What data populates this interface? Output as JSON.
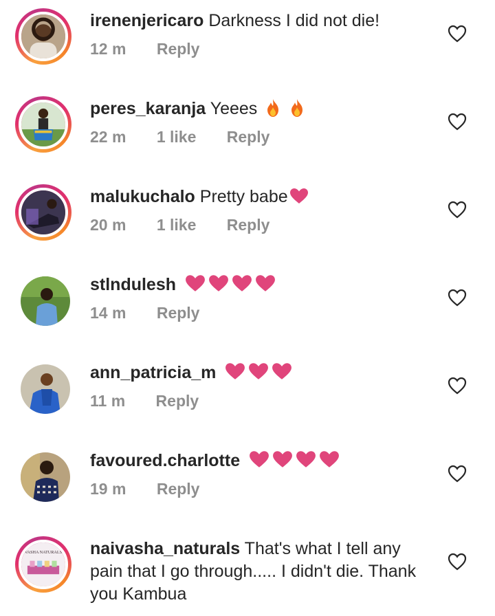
{
  "comments": [
    {
      "username": "irenenjericaro",
      "text": "Darkness I did not die!",
      "time": "12 m",
      "likes": "",
      "reply": "Reply"
    },
    {
      "username": "peres_karanja",
      "text": "Yeees",
      "time": "22 m",
      "likes": "1 like",
      "reply": "Reply",
      "emoji": "fire-x2"
    },
    {
      "username": "malukuchalo",
      "text": "Pretty babe",
      "time": "20 m",
      "likes": "1 like",
      "reply": "Reply",
      "emoji": "heart-x1"
    },
    {
      "username": "stlndulesh",
      "text": "",
      "time": "14 m",
      "likes": "",
      "reply": "Reply",
      "emoji": "heart-x4"
    },
    {
      "username": "ann_patricia_m",
      "text": "",
      "time": "11 m",
      "likes": "",
      "reply": "Reply",
      "emoji": "heart-x3"
    },
    {
      "username": "favoured.charlotte",
      "text": "",
      "time": "19 m",
      "likes": "",
      "reply": "Reply",
      "emoji": "heart-x4"
    },
    {
      "username": "naivasha_naturals",
      "text": "That's what I tell any pain that I go through..... I didn't die. Thank you Kambua",
      "avatar_text": "VASHA NATURALS",
      "time": "",
      "likes": "",
      "reply": ""
    }
  ],
  "colors": {
    "heart": "#e0457b",
    "meta": "#8e8e8e",
    "text": "#262626"
  }
}
